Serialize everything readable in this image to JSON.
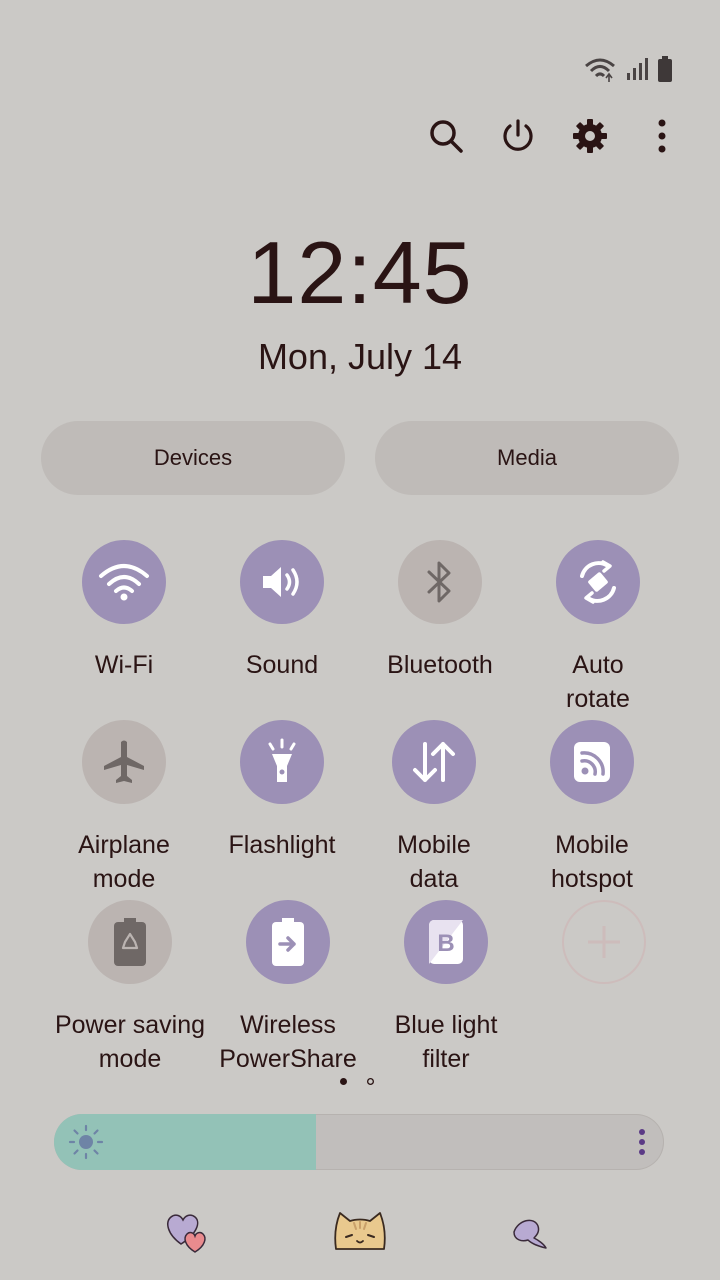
{
  "clock": {
    "time": "12:45",
    "date": "Mon, July 14"
  },
  "panels": {
    "devices": "Devices",
    "media": "Media"
  },
  "tiles": [
    {
      "label": "Wi-Fi",
      "state": "on",
      "icon": "wifi-icon"
    },
    {
      "label": "Sound",
      "state": "on",
      "icon": "sound-icon"
    },
    {
      "label": "Bluetooth",
      "state": "off",
      "icon": "bluetooth-icon"
    },
    {
      "label": "Auto\nrotate",
      "state": "on",
      "icon": "auto-rotate-icon"
    },
    {
      "label": "Airplane\nmode",
      "state": "off",
      "icon": "airplane-icon"
    },
    {
      "label": "Flashlight",
      "state": "on",
      "icon": "flashlight-icon"
    },
    {
      "label": "Mobile\ndata",
      "state": "on",
      "icon": "mobile-data-icon"
    },
    {
      "label": "Mobile\nhotspot",
      "state": "on",
      "icon": "hotspot-icon"
    },
    {
      "label": "Power saving\nmode",
      "state": "off",
      "icon": "power-saving-icon"
    },
    {
      "label": "Wireless\nPowerShare",
      "state": "on",
      "icon": "wireless-powershare-icon"
    },
    {
      "label": "Blue light\nfilter",
      "state": "on",
      "icon": "blue-light-filter-icon"
    }
  ],
  "pager": {
    "pages": 2,
    "current": 1
  },
  "brightness": {
    "level": 0.43
  },
  "colors": {
    "background": "#cbc9c6",
    "tile_on": "#9c90b6",
    "tile_off": "#bbb4b1",
    "slider_fill": "#93c2b7",
    "text": "#2a1414"
  }
}
